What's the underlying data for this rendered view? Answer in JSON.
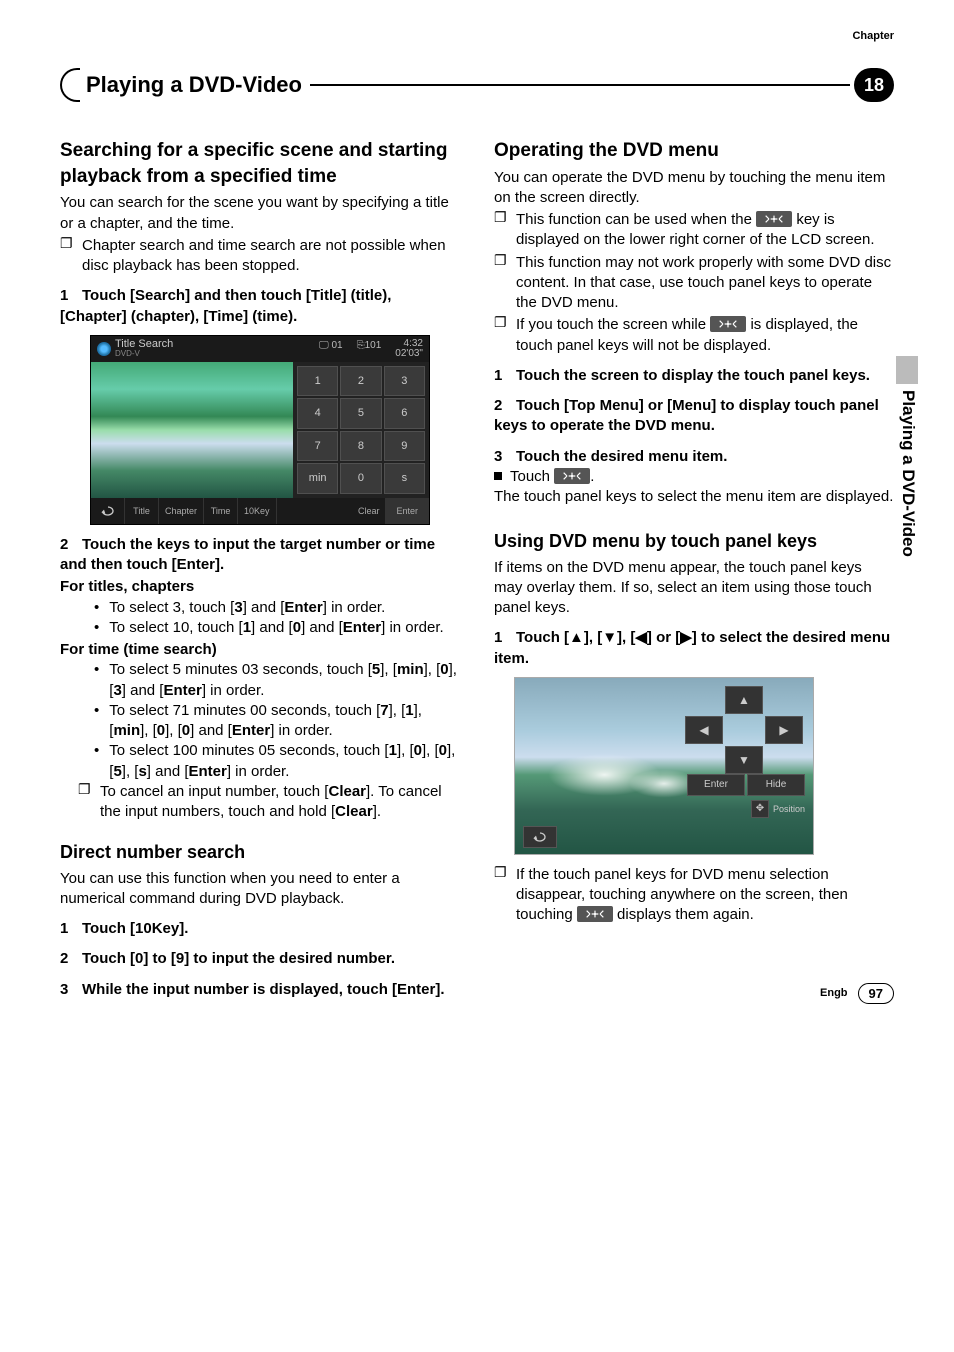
{
  "header": {
    "chapter_label": "Chapter",
    "chapter_number": "18",
    "page_title": "Playing a DVD-Video",
    "side_tab": "Playing a DVD-Video"
  },
  "left": {
    "h_search": "Searching for a specific scene and starting playback from a specified time",
    "p_search_intro": "You can search for the scene you want by specifying a title or a chapter, and the time.",
    "note_search": "Chapter search and time search are not possible when disc playback has been stopped.",
    "step1": "Touch [Search] and then touch [Title] (title), [Chapter] (chapter), [Time] (time).",
    "ss1": {
      "title": "Title Search",
      "dvdv": "DVD-V",
      "icons_center": "01",
      "icons_right1": "101",
      "time": "4:32",
      "elapsed": "02'03\"",
      "keys": [
        "1",
        "2",
        "3",
        "4",
        "5",
        "6",
        "7",
        "8",
        "9",
        "min",
        "0",
        "s"
      ],
      "bottom": [
        "Title",
        "Chapter",
        "Time",
        "10Key",
        "",
        "Clear",
        "Enter"
      ]
    },
    "step2": "Touch the keys to input the target number or time and then touch [Enter].",
    "sub_titles": "For titles, chapters",
    "b_t1_a": "To select 3, touch [",
    "b_t1_b": "3",
    "b_t1_c": "] and [",
    "b_t1_d": "Enter",
    "b_t1_e": "] in order.",
    "b_t2_a": "To select 10, touch [",
    "b_t2_b": "1",
    "b_t2_c": "] and [",
    "b_t2_d": "0",
    "b_t2_e": "] and [",
    "b_t2_f": "Enter",
    "b_t2_g": "] in order.",
    "sub_time": "For time (time search)",
    "b_tm1_a": "To select 5 minutes 03 seconds, touch [",
    "b_tm1_b": "5",
    "b_tm1_c": "], [",
    "b_tm1_d": "min",
    "b_tm1_e": "], [",
    "b_tm1_f": "0",
    "b_tm1_g": "], [",
    "b_tm1_h": "3",
    "b_tm1_i": "] and [",
    "b_tm1_j": "Enter",
    "b_tm1_k": "] in order.",
    "b_tm2_a": "To select 71 minutes 00 seconds, touch [",
    "b_tm2_b": "7",
    "b_tm2_c": "], [",
    "b_tm2_d": "1",
    "b_tm2_e": "], [",
    "b_tm2_f": "min",
    "b_tm2_g": "], [",
    "b_tm2_h": "0",
    "b_tm2_i": "], [",
    "b_tm2_j": "0",
    "b_tm2_k": "] and [",
    "b_tm2_l": "Enter",
    "b_tm2_m": "] in order.",
    "b_tm3_a": "To select 100 minutes 05 seconds, touch [",
    "b_tm3_b": "1",
    "b_tm3_c": "], [",
    "b_tm3_d": "0",
    "b_tm3_e": "], [",
    "b_tm3_f": "0",
    "b_tm3_g": "], [",
    "b_tm3_h": "5",
    "b_tm3_i": "], [",
    "b_tm3_j": "s",
    "b_tm3_k": "] and [",
    "b_tm3_l": "Enter",
    "b_tm3_m": "] in order.",
    "note_clear_a": "To cancel an input number, touch [",
    "note_clear_b": "Clear",
    "note_clear_c": "]. To cancel the input numbers, touch and hold [",
    "note_clear_d": "Clear",
    "note_clear_e": "].",
    "h_direct": "Direct number search",
    "p_direct": "You can use this function when you need to enter a numerical command during DVD playback.",
    "d_step1": "Touch [10Key].",
    "d_step2": "Touch [0] to [9] to input the desired number.",
    "d_step3": "While the input number is displayed, touch [Enter]."
  },
  "right": {
    "h_op": "Operating the DVD menu",
    "p_op": "You can operate the DVD menu by touching the menu item on the screen directly.",
    "note_op1_a": "This function can be used when the ",
    "note_op1_b": " key is displayed on the lower right corner of the LCD screen.",
    "note_op2": "This function may not work properly with some DVD disc content. In that case, use touch panel keys to operate the DVD menu.",
    "note_op3_a": "If you touch the screen while ",
    "note_op3_b": " is displayed, the touch panel keys will not be displayed.",
    "op_step1": "Touch the screen to display the touch panel keys.",
    "op_step2": "Touch [Top Menu] or [Menu] to display touch panel keys to operate the DVD menu.",
    "op_step3": "Touch the desired menu item.",
    "op_touch_label": "Touch ",
    "op_touch_after": ".",
    "op_touch_desc": "The touch panel keys to select the menu item are displayed.",
    "h_use": "Using DVD menu by touch panel keys",
    "p_use": "If items on the DVD menu appear, the touch panel keys may overlay them. If so, select an item using those touch panel keys.",
    "use_step1": "Touch [▲], [▼], [◀] or [▶] to select the desired menu item.",
    "ss2": {
      "enter": "Enter",
      "hide": "Hide",
      "position": "Position"
    },
    "note_use_a": "If the touch panel keys for DVD menu selection disappear, touching anywhere on the screen, then touching ",
    "note_use_b": " displays them again."
  },
  "footer": {
    "lang": "Engb",
    "page": "97"
  }
}
